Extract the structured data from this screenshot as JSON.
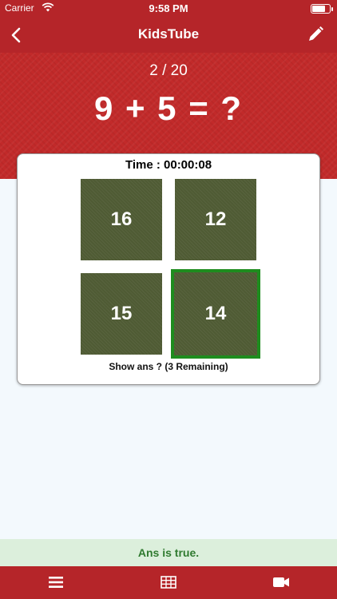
{
  "status_bar": {
    "carrier": "Carrier",
    "time": "9:58 PM",
    "battery_level": 0.75
  },
  "nav": {
    "title": "KidsTube",
    "back_icon": "chevron-left-icon",
    "edit_icon": "pencil-icon"
  },
  "quiz": {
    "progress": "2 / 20",
    "question": "9 + 5 = ?",
    "timer": "Time : 00:00:08",
    "options": [
      "16",
      "12",
      "15",
      "14"
    ],
    "selected": "14",
    "show_answer": "Show ans ? (3 Remaining)"
  },
  "result": {
    "text": "Ans is true."
  },
  "tab_bar": {
    "items": [
      "menu-icon",
      "table-icon",
      "video-camera-icon"
    ]
  },
  "colors": {
    "brand_red": "#b52529",
    "tile_green": "#4f5b34",
    "selected_border": "#1e8c1e",
    "result_bg": "#dcefdc",
    "result_text": "#2f7a2f"
  }
}
